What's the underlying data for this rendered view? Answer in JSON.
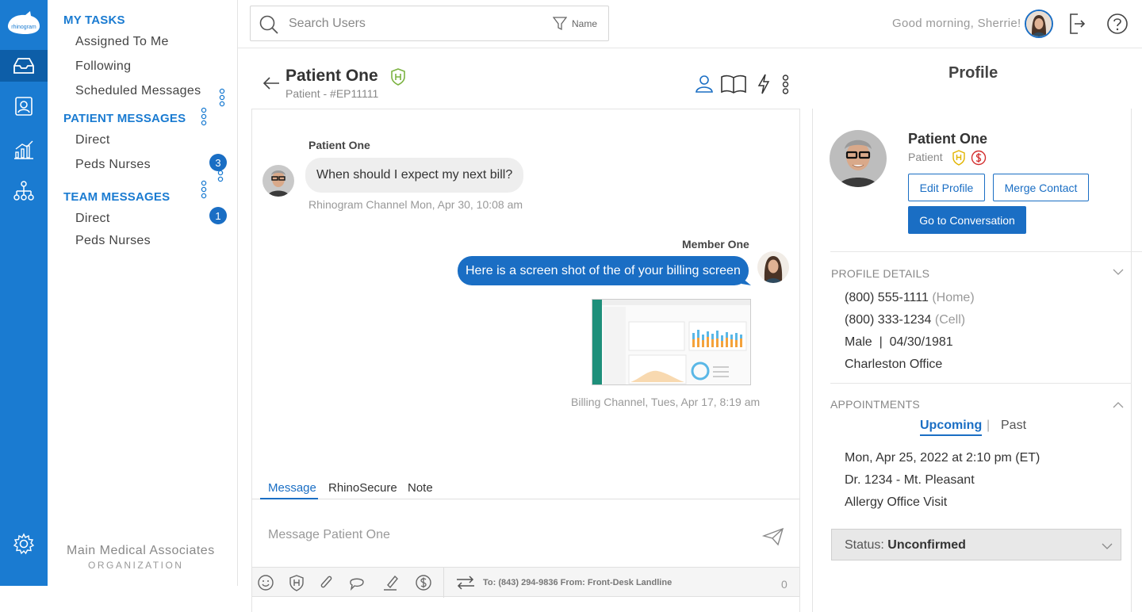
{
  "brand": {
    "logo_text": "rhinogram"
  },
  "nav": {
    "my_tasks": "MY TASKS",
    "assigned": "Assigned To Me",
    "following": "Following",
    "scheduled": "Scheduled Messages",
    "patient_messages": "PATIENT MESSAGES",
    "pm_direct": "Direct",
    "pm_peds": "Peds Nurses",
    "pm_peds_badge": "3",
    "team_messages": "TEAM MESSAGES",
    "tm_direct": "Direct",
    "tm_direct_badge": "1",
    "tm_peds": "Peds Nurses",
    "org_name": "Main Medical Associates",
    "org_type": "ORGANIZATION"
  },
  "topbar": {
    "search_placeholder": "Search Users",
    "filter_label": "Name",
    "greeting": "Good morning, Sherrie!"
  },
  "conversation": {
    "name": "Patient One",
    "sub": "Patient - #EP11111",
    "messages": [
      {
        "sender": "Patient One",
        "text": "When should I expect my next bill?",
        "meta": "Rhinogram Channel Mon, Apr 30, 10:08 am"
      },
      {
        "sender": "Member One",
        "text": "Here is a screen shot of the of your billing screen",
        "meta": "Billing Channel, Tues, Apr 17, 8:19 am"
      }
    ],
    "tabs": [
      "Message",
      "RhinoSecure",
      "Note"
    ],
    "composer_placeholder": "Message Patient One",
    "route": "To: (843) 294-9836  From: Front-Desk Landline",
    "char_count": "0"
  },
  "profile": {
    "title": "Profile",
    "name": "Patient One",
    "role": "Patient",
    "edit_label": "Edit Profile",
    "merge_label": "Merge Contact",
    "goto_label": "Go to Conversation",
    "details_heading": "PROFILE DETAILS",
    "phone1": "(800) 555-1111",
    "phone1_type": "(Home)",
    "phone2": "(800) 333-1234",
    "phone2_type": "(Cell)",
    "gender_dob": "Male  |  04/30/1981",
    "office": "Charleston Office",
    "appointments_heading": "APPOINTMENTS",
    "upcoming": "Upcoming",
    "past": "Past",
    "separator": "|",
    "appt_time": "Mon, Apr 25, 2022 at 2:10 pm (ET)",
    "appt_doctor": "Dr. 1234 - Mt. Pleasant",
    "appt_type": "Allergy Office Visit",
    "status_label": "Status:",
    "status_value": "Unconfirmed"
  },
  "colors": {
    "brand_blue": "#1a7bd1",
    "accent_blue": "#1a6ec4",
    "hipaa_green": "#7cb342",
    "hipaa_yellow": "#e2b400",
    "billing_red": "#d32f2f"
  }
}
